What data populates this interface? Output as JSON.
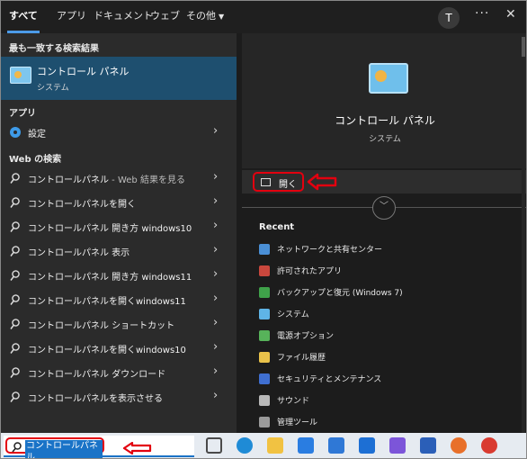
{
  "tabs": [
    {
      "label": "すべて"
    },
    {
      "label": "アプリ"
    },
    {
      "label": "ドキュメント"
    },
    {
      "label": "ウェブ"
    },
    {
      "label": "その他"
    }
  ],
  "header": {
    "avatar": "T",
    "more": "···",
    "close": "✕"
  },
  "left": {
    "best_match_heading": "最も一致する検索結果",
    "best_match": {
      "title": "コントロール パネル",
      "subtitle": "システム"
    },
    "apps_heading": "アプリ",
    "apps": [
      {
        "label": "設定"
      }
    ],
    "web_heading": "Web の検索",
    "web": [
      {
        "label": "コントロールパネル",
        "suffix": " - Web 結果を見る"
      },
      {
        "label": "コントロールパネルを開く",
        "suffix": ""
      },
      {
        "label": "コントロールパネル 開き方 windows10",
        "suffix": ""
      },
      {
        "label": "コントロールパネル 表示",
        "suffix": ""
      },
      {
        "label": "コントロールパネル 開き方 windows11",
        "suffix": ""
      },
      {
        "label": "コントロールパネルを開くwindows11",
        "suffix": ""
      },
      {
        "label": "コントロールパネル ショートカット",
        "suffix": ""
      },
      {
        "label": "コントロールパネルを開くwindows10",
        "suffix": ""
      },
      {
        "label": "コントロールパネル ダウンロード",
        "suffix": ""
      },
      {
        "label": "コントロールパネルを表示させる",
        "suffix": ""
      }
    ]
  },
  "right": {
    "title": "コントロール パネル",
    "subtitle": "システム",
    "open_label": "開く",
    "recent_heading": "Recent",
    "recent": [
      {
        "label": "ネットワークと共有センター",
        "color": "#4a8fd6"
      },
      {
        "label": "許可されたアプリ",
        "color": "#c9473d"
      },
      {
        "label": "バックアップと復元 (Windows 7)",
        "color": "#3fa24a"
      },
      {
        "label": "システム",
        "color": "#5fb4e6"
      },
      {
        "label": "電源オプション",
        "color": "#57b35a"
      },
      {
        "label": "ファイル履歴",
        "color": "#e9c24a"
      },
      {
        "label": "セキュリティとメンテナンス",
        "color": "#3f6fd1"
      },
      {
        "label": "サウンド",
        "color": "#b8b8b8"
      },
      {
        "label": "管理ツール",
        "color": "#9a9a9a"
      }
    ]
  },
  "taskbar": {
    "search_value": "コントロールパネル",
    "icons": [
      {
        "name": "task-view-icon",
        "color": "#4a4a4a"
      },
      {
        "name": "edge-icon",
        "color": "#1f8bd6"
      },
      {
        "name": "file-explorer-icon",
        "color": "#f1c242"
      },
      {
        "name": "dictionary-app-icon",
        "color": "#2a7de1"
      },
      {
        "name": "microsoft-store-icon",
        "color": "#2f78d6"
      },
      {
        "name": "mail-icon",
        "color": "#1d6fd4"
      },
      {
        "name": "copilot-icon",
        "color": "#7c55d9"
      },
      {
        "name": "word-icon",
        "color": "#2b5fb8"
      },
      {
        "name": "firefox-icon",
        "color": "#e8702a"
      },
      {
        "name": "chrome-icon",
        "color": "#d93b31"
      }
    ]
  },
  "accent_color": "#4c9be8",
  "highlight_color": "#e3000f"
}
